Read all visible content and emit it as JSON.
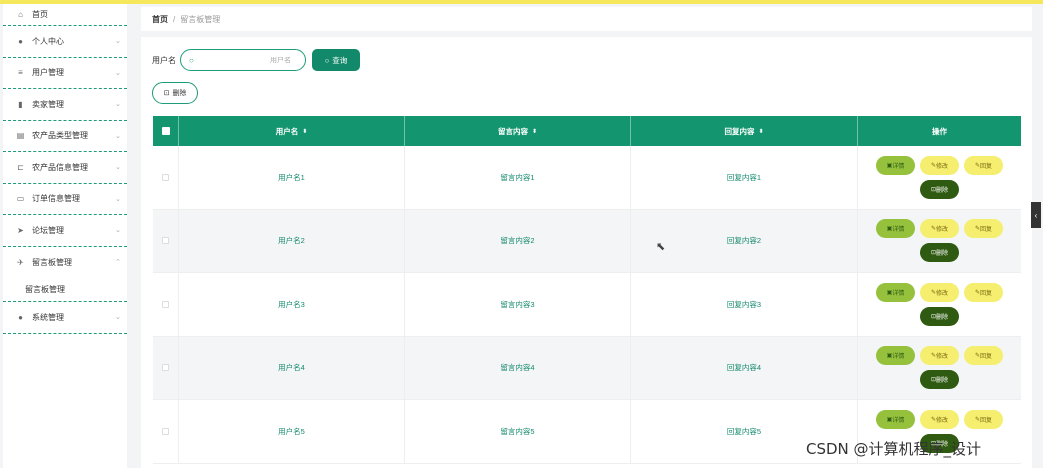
{
  "sidebar": {
    "home": "首页",
    "items": [
      {
        "label": "个人中心",
        "icon": "user-icon"
      },
      {
        "label": "用户管理",
        "icon": "list-icon"
      },
      {
        "label": "卖家管理",
        "icon": "chart-icon"
      },
      {
        "label": "农产品类型管理",
        "icon": "stack-icon"
      },
      {
        "label": "农产品信息管理",
        "icon": "crop-icon"
      },
      {
        "label": "订单信息管理",
        "icon": "message-icon"
      },
      {
        "label": "论坛管理",
        "icon": "send-icon"
      },
      {
        "label": "留言板管理",
        "icon": "plane-icon"
      },
      {
        "label": "系统管理",
        "icon": "user-icon"
      }
    ],
    "sub_item": "留言板管理"
  },
  "breadcrumb": {
    "home": "首页",
    "separator": "/",
    "current": "留言板管理"
  },
  "search": {
    "label": "用户名",
    "placeholder": "用户名",
    "button": "查询"
  },
  "toolbar": {
    "delete": "删除"
  },
  "table": {
    "headers": {
      "user": "用户名",
      "message": "留言内容",
      "reply": "回复内容",
      "ops": "操作"
    },
    "rows": [
      {
        "user": "用户名1",
        "message": "留言内容1",
        "reply": "回复内容1"
      },
      {
        "user": "用户名2",
        "message": "留言内容2",
        "reply": "回复内容2"
      },
      {
        "user": "用户名3",
        "message": "留言内容3",
        "reply": "回复内容3"
      },
      {
        "user": "用户名4",
        "message": "留言内容4",
        "reply": "回复内容4"
      },
      {
        "user": "用户名5",
        "message": "留言内容5",
        "reply": "回复内容5"
      }
    ],
    "actions": {
      "detail": "详情",
      "edit": "修改",
      "reply": "回复",
      "delete": "删除"
    }
  },
  "watermark": "CSDN @计算机程序_设计",
  "colors": {
    "accent": "#13966f",
    "top_line": "#f5e85c",
    "detail": "#95c13d",
    "edit": "#f5ee6e",
    "delete": "#2f5a11"
  }
}
